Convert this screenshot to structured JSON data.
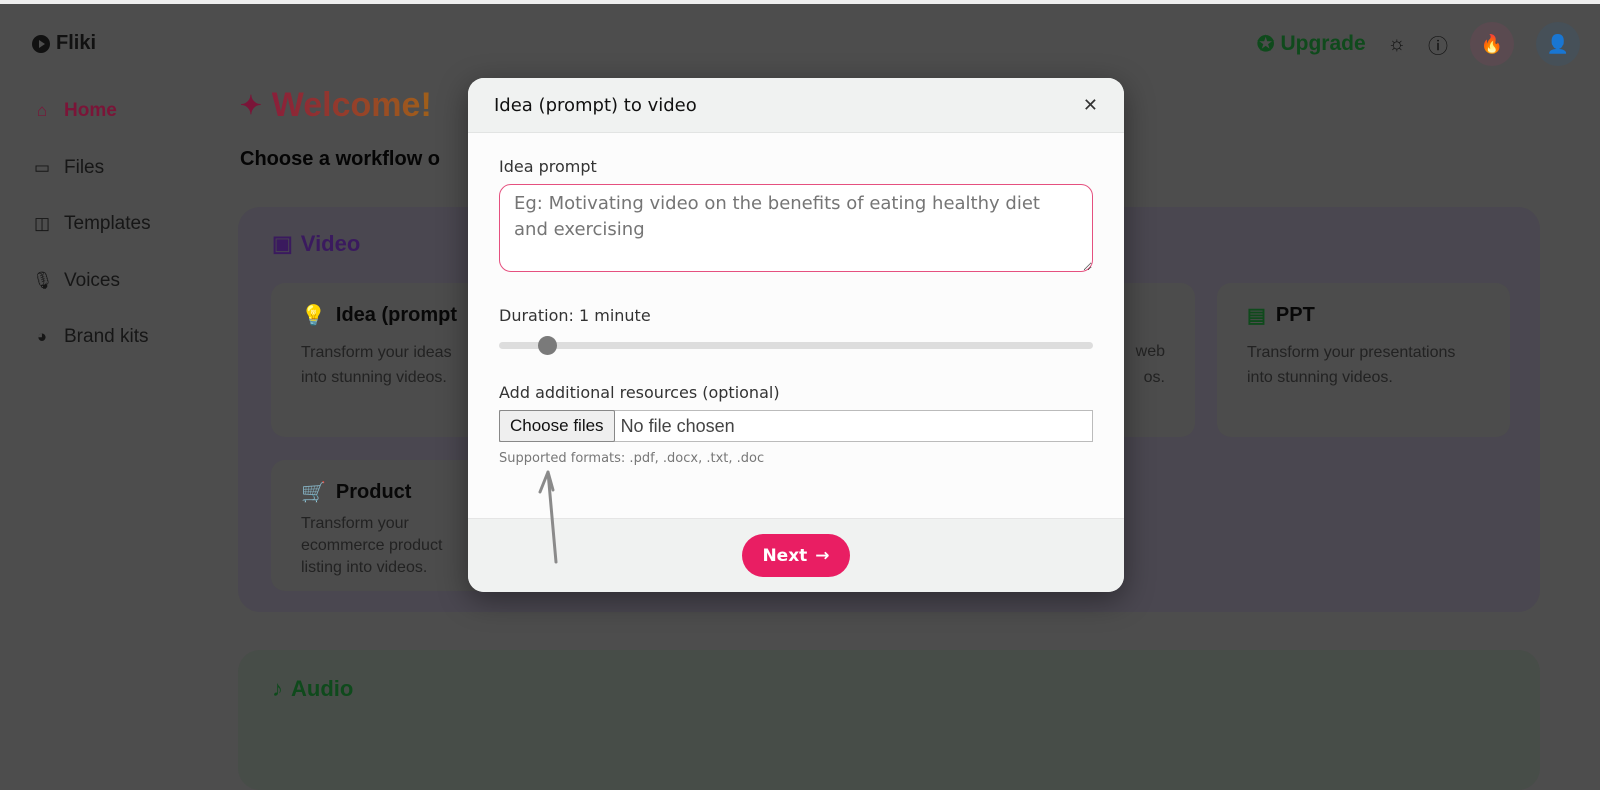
{
  "app": {
    "name": "Fliki"
  },
  "sidebar": {
    "items": [
      {
        "label": "Home",
        "icon": "home-icon",
        "active": true
      },
      {
        "label": "Files",
        "icon": "folder-icon"
      },
      {
        "label": "Templates",
        "icon": "layout-icon"
      },
      {
        "label": "Voices",
        "icon": "microphone-icon"
      },
      {
        "label": "Brand kits",
        "icon": "palette-icon"
      }
    ]
  },
  "header": {
    "upgrade_label": "Upgrade"
  },
  "main": {
    "welcome": "Welcome!",
    "subtitle": "Choose a workflow o",
    "video_section": {
      "title": "Video",
      "cards": [
        {
          "title": "Idea (prompt",
          "desc": "Transform your ideas into stunning videos."
        },
        {
          "desc_line1": "web",
          "desc_line2": "os."
        },
        {
          "title": "PPT",
          "desc": "Transform your presentations into stunning videos."
        },
        {
          "title": "Product",
          "desc": "Transform your ecommerce product listing into videos."
        }
      ]
    },
    "audio_section": {
      "title": "Audio"
    }
  },
  "modal": {
    "title": "Idea (prompt) to video",
    "prompt_label": "Idea prompt",
    "prompt_placeholder": "Eg: Motivating video on the benefits of eating healthy diet and exercising",
    "prompt_value": "",
    "duration_label": "Duration: 1 minute",
    "duration_fraction": 0.08,
    "resources_label": "Add additional resources (optional)",
    "choose_files_label": "Choose files",
    "file_status": "No file chosen",
    "formats_hint": "Supported formats: .pdf, .docx, .txt, .doc",
    "next_label": "Next"
  },
  "colors": {
    "accent": "#e91e63",
    "upgrade": "#1b7a2e",
    "video": "#6a2aa8",
    "audio": "#1e6b2e"
  }
}
